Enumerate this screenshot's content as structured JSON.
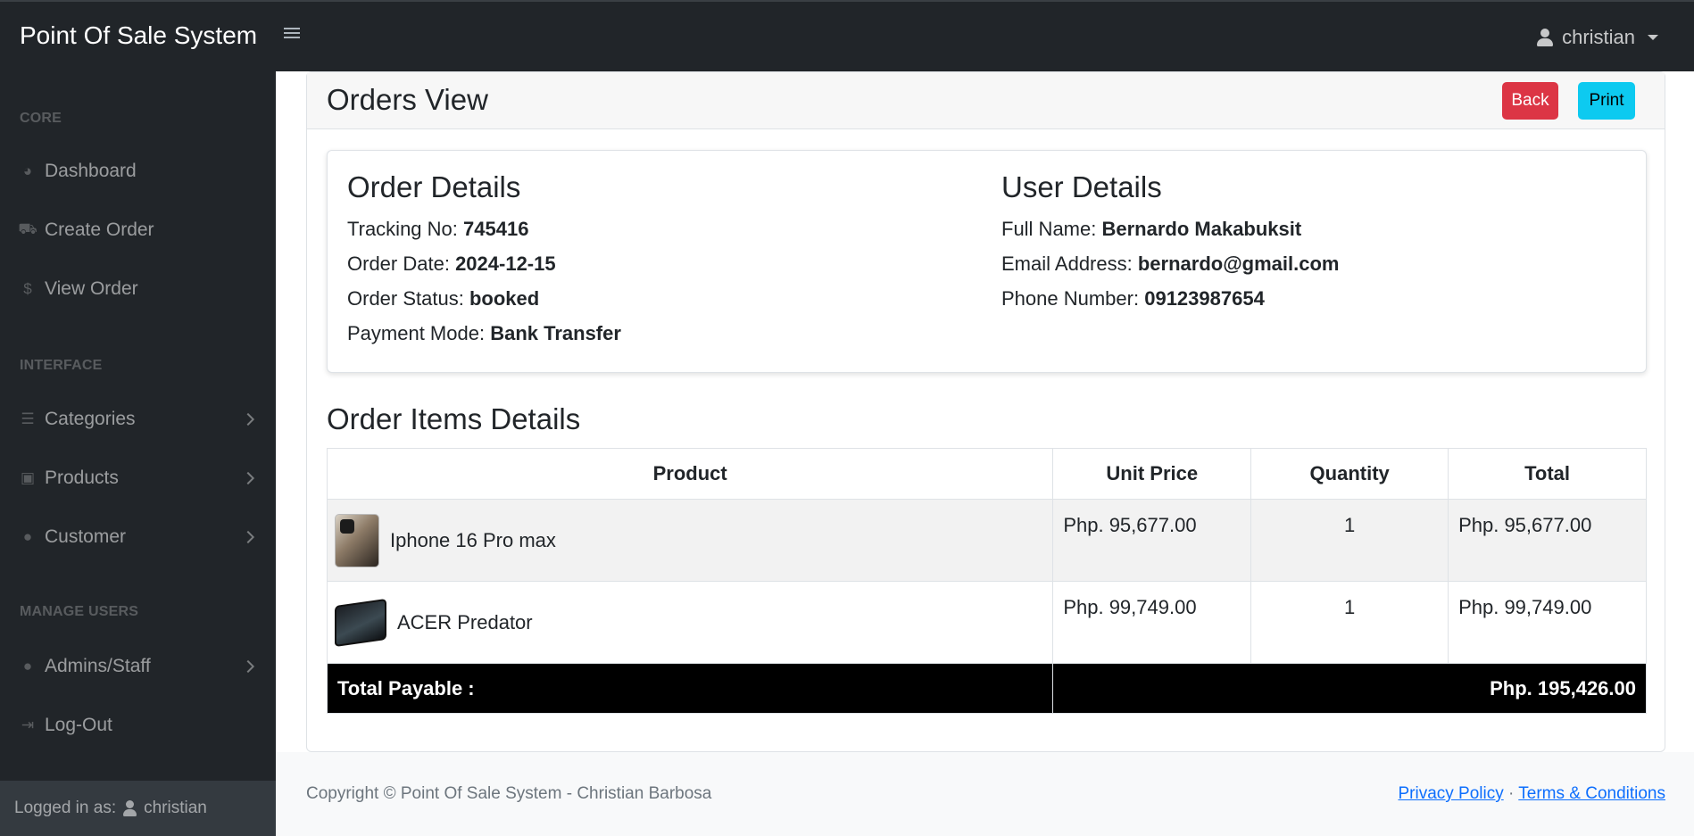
{
  "app": {
    "brand": "Point Of Sale System",
    "user": "christian"
  },
  "sidebar": {
    "headings": [
      "CORE",
      "INTERFACE",
      "MANAGE USERS"
    ],
    "items": [
      {
        "label": "Dashboard",
        "icon": "dashboard-icon"
      },
      {
        "label": "Create Order",
        "icon": "cart-icon"
      },
      {
        "label": "View Order",
        "icon": "money-bag-icon"
      },
      {
        "label": "Categories",
        "icon": "list-icon"
      },
      {
        "label": "Products",
        "icon": "shopping-bag-icon"
      },
      {
        "label": "Customer",
        "icon": "user-icon"
      },
      {
        "label": "Admins/Staff",
        "icon": "user-tie-icon"
      },
      {
        "label": "Log-Out",
        "icon": "logout-icon"
      }
    ],
    "footer_label": "Logged in as:",
    "footer_user": "christian"
  },
  "page": {
    "title": "Orders View",
    "back_label": "Back",
    "print_label": "Print"
  },
  "order_details": {
    "heading": "Order Details",
    "tracking_label": "Tracking No:",
    "tracking": "745416",
    "date_label": "Order Date:",
    "date": "2024-12-15",
    "status_label": "Order Status:",
    "status": "booked",
    "payment_label": "Payment Mode:",
    "payment": "Bank Transfer"
  },
  "user_details": {
    "heading": "User Details",
    "name_label": "Full Name:",
    "name": "Bernardo Makabuksit",
    "email_label": "Email Address:",
    "email": "bernardo@gmail.com",
    "phone_label": "Phone Number:",
    "phone": "09123987654"
  },
  "items": {
    "heading": "Order Items Details",
    "columns": [
      "Product",
      "Unit Price",
      "Quantity",
      "Total"
    ],
    "rows": [
      {
        "product": "Iphone 16 Pro max",
        "unit_price": "Php. 95,677.00",
        "quantity": "1",
        "total": "Php. 95,677.00"
      },
      {
        "product": "ACER Predator",
        "unit_price": "Php. 99,749.00",
        "quantity": "1",
        "total": "Php. 99,749.00"
      }
    ],
    "total_label": "Total Payable :",
    "total_value": "Php. 195,426.00"
  },
  "footer": {
    "copyright": "Copyright © Point Of Sale System - Christian Barbosa",
    "privacy": "Privacy Policy",
    "separator": "·",
    "terms": "Terms & Conditions"
  }
}
